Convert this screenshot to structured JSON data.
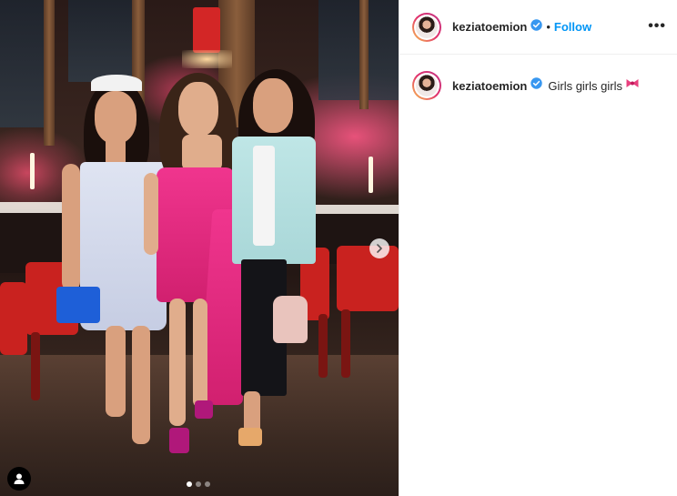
{
  "post": {
    "username": "keziatoemion",
    "separator": "•",
    "follow_label": "Follow",
    "more_label": "•••",
    "caption_text": "Girls girls girls",
    "caption_emoji": "ribbon-icon",
    "verified": true
  },
  "carousel": {
    "slide_count": 3,
    "active_index": 0
  },
  "icons": {
    "verified": "verified-badge-icon",
    "next": "chevron-right-icon",
    "tagged_user": "user-tag-icon",
    "more": "more-options-icon"
  },
  "colors": {
    "accent": "#0095f6",
    "text": "#262626",
    "border": "#efefef"
  }
}
